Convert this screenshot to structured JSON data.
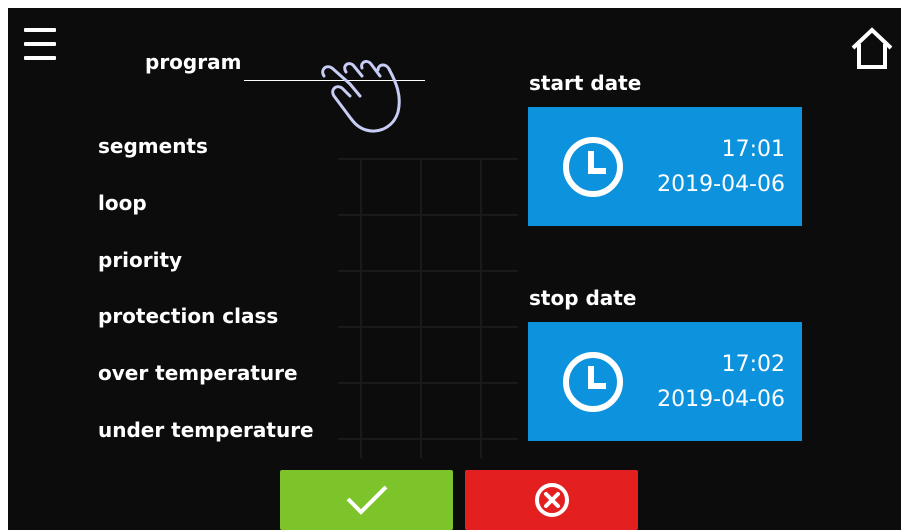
{
  "header": {
    "menu_icon": "hamburger-menu-icon",
    "home_icon": "home-icon"
  },
  "program": {
    "label": "program",
    "value": "",
    "hint_icon": "pointing-hand-icon"
  },
  "parameters": [
    {
      "label": "segments"
    },
    {
      "label": "loop"
    },
    {
      "label": "priority"
    },
    {
      "label": "protection class"
    },
    {
      "label": "over temperature"
    },
    {
      "label": "under temperature"
    }
  ],
  "start": {
    "label": "start date",
    "time": "17:01",
    "date": "2019-04-06",
    "icon": "clock-icon"
  },
  "stop": {
    "label": "stop date",
    "time": "17:02",
    "date": "2019-04-06",
    "icon": "clock-icon"
  },
  "actions": {
    "confirm_icon": "checkmark-icon",
    "cancel_icon": "cancel-circle-x-icon"
  },
  "colors": {
    "background": "#0c0c0c",
    "date_button": "#0d92dd",
    "confirm": "#7cc42a",
    "cancel": "#e41f1f"
  }
}
